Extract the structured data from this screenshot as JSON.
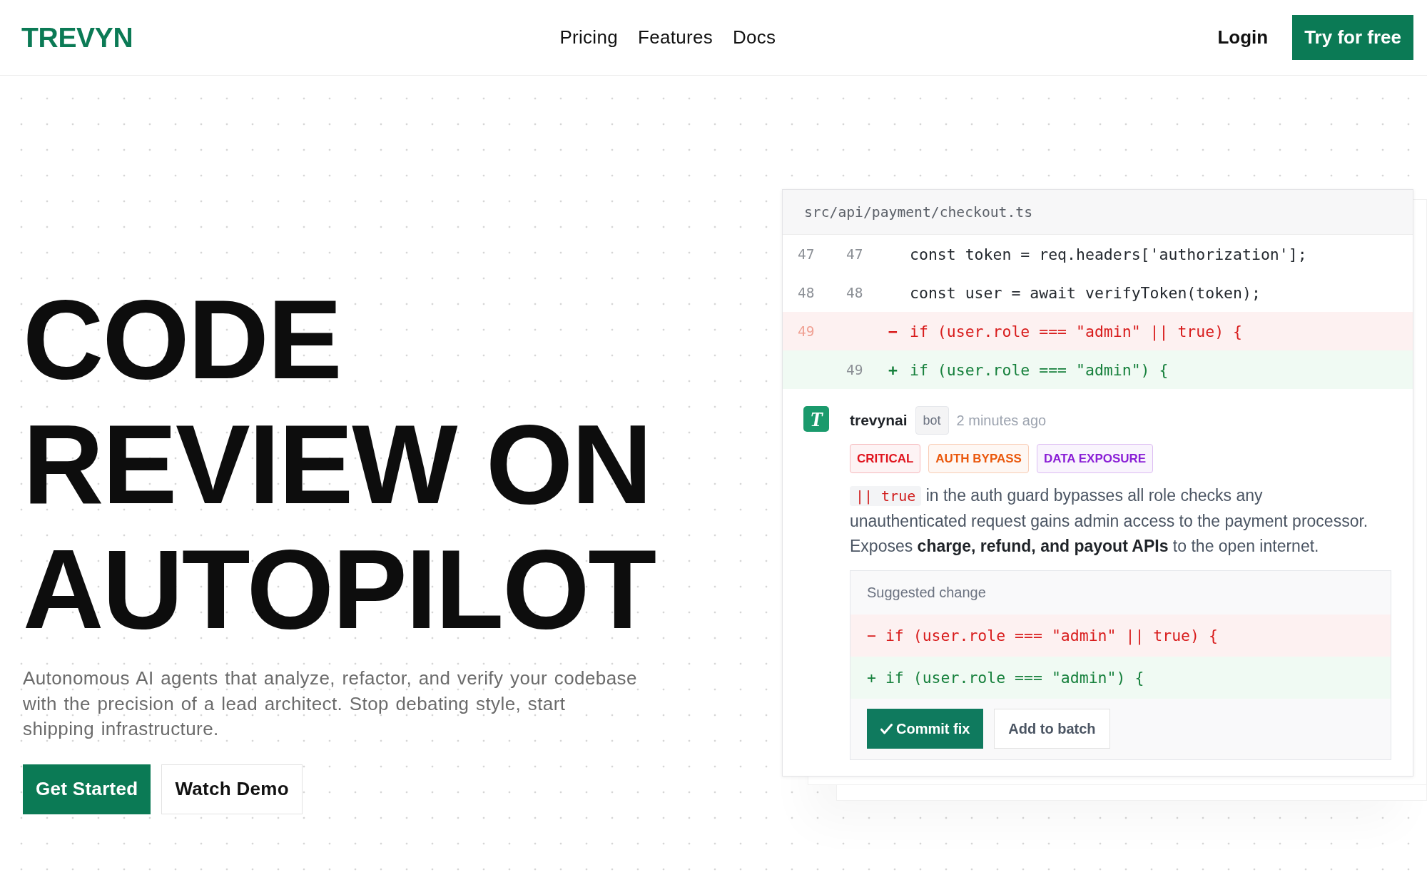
{
  "header": {
    "logo": "TREVYN",
    "nav_links": [
      "Pricing",
      "Features",
      "Docs"
    ],
    "login": "Login",
    "cta": "Try for free"
  },
  "hero": {
    "title": "CODE REVIEW ON AUTOPILOT",
    "subtitle": "Autonomous AI agents that analyze, refactor, and verify your codebase with the precision of a lead architect. Stop debating style, start shipping infrastructure.",
    "buttons": [
      {
        "label": "Get Started",
        "kind": "primary"
      },
      {
        "label": "Watch Demo",
        "kind": "secondary"
      }
    ]
  },
  "review_panel": {
    "file_path": "src/api/payment/checkout.ts",
    "diff_rows": [
      {
        "kind": "context",
        "old_line": "47",
        "new_line": "47",
        "code": "const token = req.headers['authorization'];"
      },
      {
        "kind": "context",
        "old_line": "48",
        "new_line": "48",
        "code": "const user = await verifyToken(token);"
      },
      {
        "kind": "removed",
        "old_line": "49",
        "sign": "−",
        "code": "if (user.role === \"admin\" || true) {"
      },
      {
        "kind": "added",
        "new_line": "49",
        "sign": "+",
        "code": "if (user.role === \"admin\") {"
      }
    ],
    "comment": {
      "avatar_letter": "T",
      "author": "trevynai",
      "badge": "bot",
      "time": "2 minutes ago",
      "tags": [
        {
          "label": "CRITICAL",
          "color": "#e0141e"
        },
        {
          "label": "AUTH BYPASS",
          "color": "#ea580c"
        },
        {
          "label": "DATA EXPOSURE",
          "color": "#8a1fd6"
        }
      ],
      "inline_code": "|| true",
      "text": "in the auth guard bypasses all role checks any unauthenticated request gains admin access to the payment processor. Exposes **charge, refund, and payout APIs** to the open internet.",
      "suggestion": {
        "title": "Suggested change",
        "lines": [
          {
            "kind": "removed",
            "code": "− if (user.role === \"admin\" || true) {"
          },
          {
            "kind": "added",
            "code": "+ if (user.role === \"admin\") {"
          }
        ],
        "buttons": [
          {
            "label": "Commit fix",
            "kind": "primary"
          },
          {
            "label": "Add to batch",
            "kind": "secondary"
          }
        ]
      }
    }
  }
}
